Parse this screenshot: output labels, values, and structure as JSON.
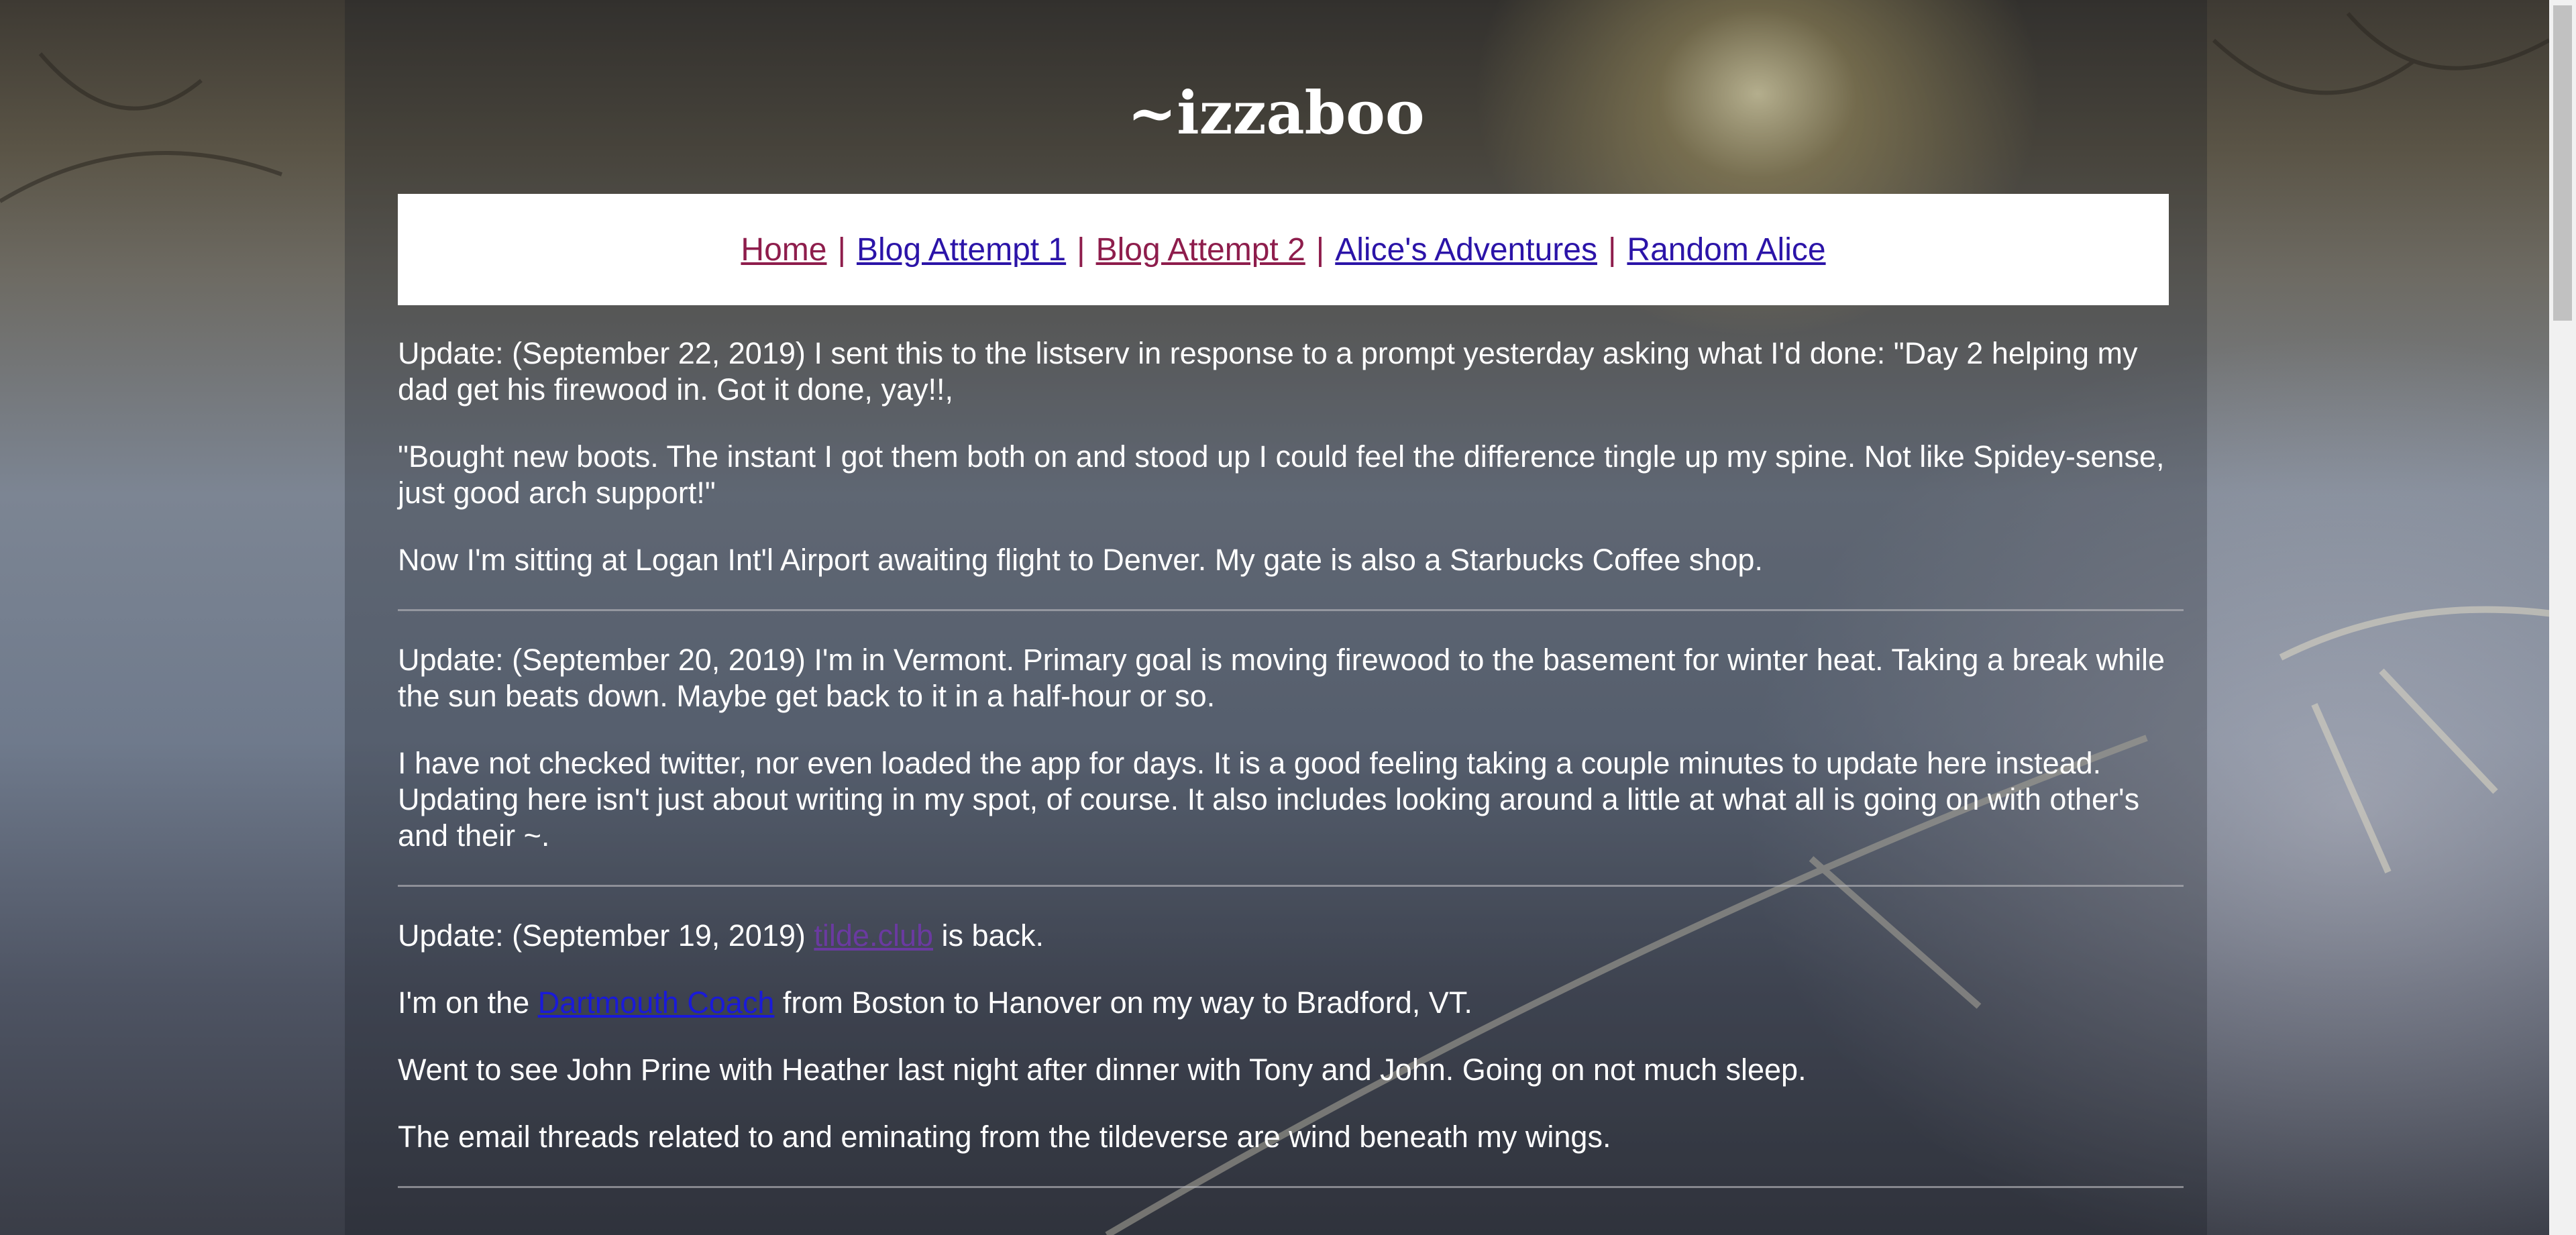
{
  "site": {
    "title": "~izzaboo"
  },
  "nav": {
    "items": [
      {
        "label": "Home",
        "state": "visited"
      },
      {
        "label": "Blog Attempt 1",
        "state": "unvisited"
      },
      {
        "label": "Blog Attempt 2",
        "state": "visited"
      },
      {
        "label": "Alice's Adventures",
        "state": "unvisited"
      },
      {
        "label": "Random Alice",
        "state": "unvisited"
      }
    ],
    "separator": "|"
  },
  "posts": [
    {
      "paragraphs": [
        "Update: (September 22, 2019) I sent this to the listserv in response to a prompt yesterday asking what I'd done: \"Day 2 helping my dad get his firewood in. Got it done, yay!!,",
        "\"Bought new boots. The instant I got them both on and stood up I could feel the difference tingle up my spine. Not like Spidey-sense, just good arch support!\"",
        "Now I'm sitting at Logan Int'l Airport awaiting flight to Denver. My gate is also a Starbucks Coffee shop."
      ]
    },
    {
      "paragraphs": [
        "Update: (September 20, 2019) I'm in Vermont. Primary goal is moving firewood to the basement for winter heat. Taking a break while the sun beats down. Maybe get back to it in a half-hour or so.",
        "I have not checked twitter, nor even loaded the app for days. It is a good feeling taking a couple minutes to update here instead. Updating here isn't just about writing in my spot, of course. It also includes looking around a little at what all is going on with other's and their ~."
      ]
    },
    {
      "p1": {
        "before": "Update: (September 19, 2019) ",
        "link": "tilde.club",
        "after": " is back."
      },
      "p2": {
        "before": "I'm on the ",
        "link": "Dartmouth Coach",
        "after": " from Boston to Hanover on my way to Bradford, VT."
      },
      "p3": "Went to see John Prine with Heather last night after dinner with Tony and John. Going on not much sleep.",
      "p4": "The email threads related to and eminating from the tildeverse are wind beneath my wings."
    }
  ],
  "colors": {
    "nav_visited": "#8e1d4c",
    "nav_unvisited": "#2b14a8",
    "text": "#ffffff",
    "link_visited": "#6a3aa0",
    "link_unvisited": "#1a1ad8"
  }
}
